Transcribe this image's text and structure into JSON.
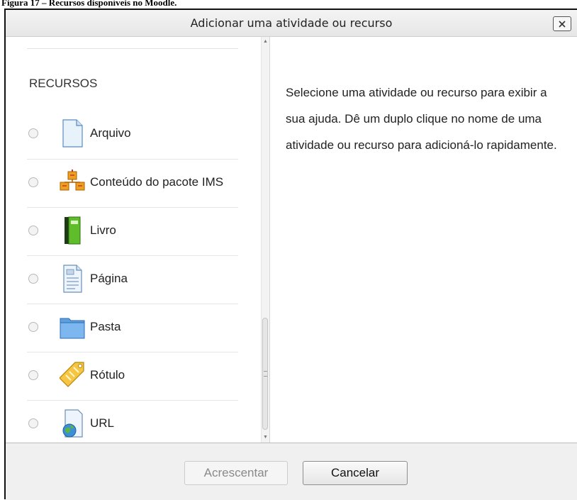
{
  "caption": "Figura 17 – Recursos disponíveis no Moodle.",
  "dialog": {
    "title": "Adicionar uma atividade ou recurso",
    "close_label": "X"
  },
  "resources": {
    "heading": "RECURSOS",
    "items": [
      {
        "label": "Arquivo",
        "icon": "file-icon"
      },
      {
        "label": "Conteúdo do pacote IMS",
        "icon": "ims-package-icon"
      },
      {
        "label": "Livro",
        "icon": "book-icon"
      },
      {
        "label": "Página",
        "icon": "page-icon"
      },
      {
        "label": "Pasta",
        "icon": "folder-icon"
      },
      {
        "label": "Rótulo",
        "icon": "label-tag-icon"
      },
      {
        "label": "URL",
        "icon": "url-globe-icon"
      }
    ]
  },
  "help": {
    "text": "Selecione uma atividade ou recurso para exibir a sua ajuda. Dê um duplo clique no nome de uma atividade ou recurso para adicioná-lo rapidamente."
  },
  "footer": {
    "add_label": "Acrescentar",
    "cancel_label": "Cancelar"
  }
}
